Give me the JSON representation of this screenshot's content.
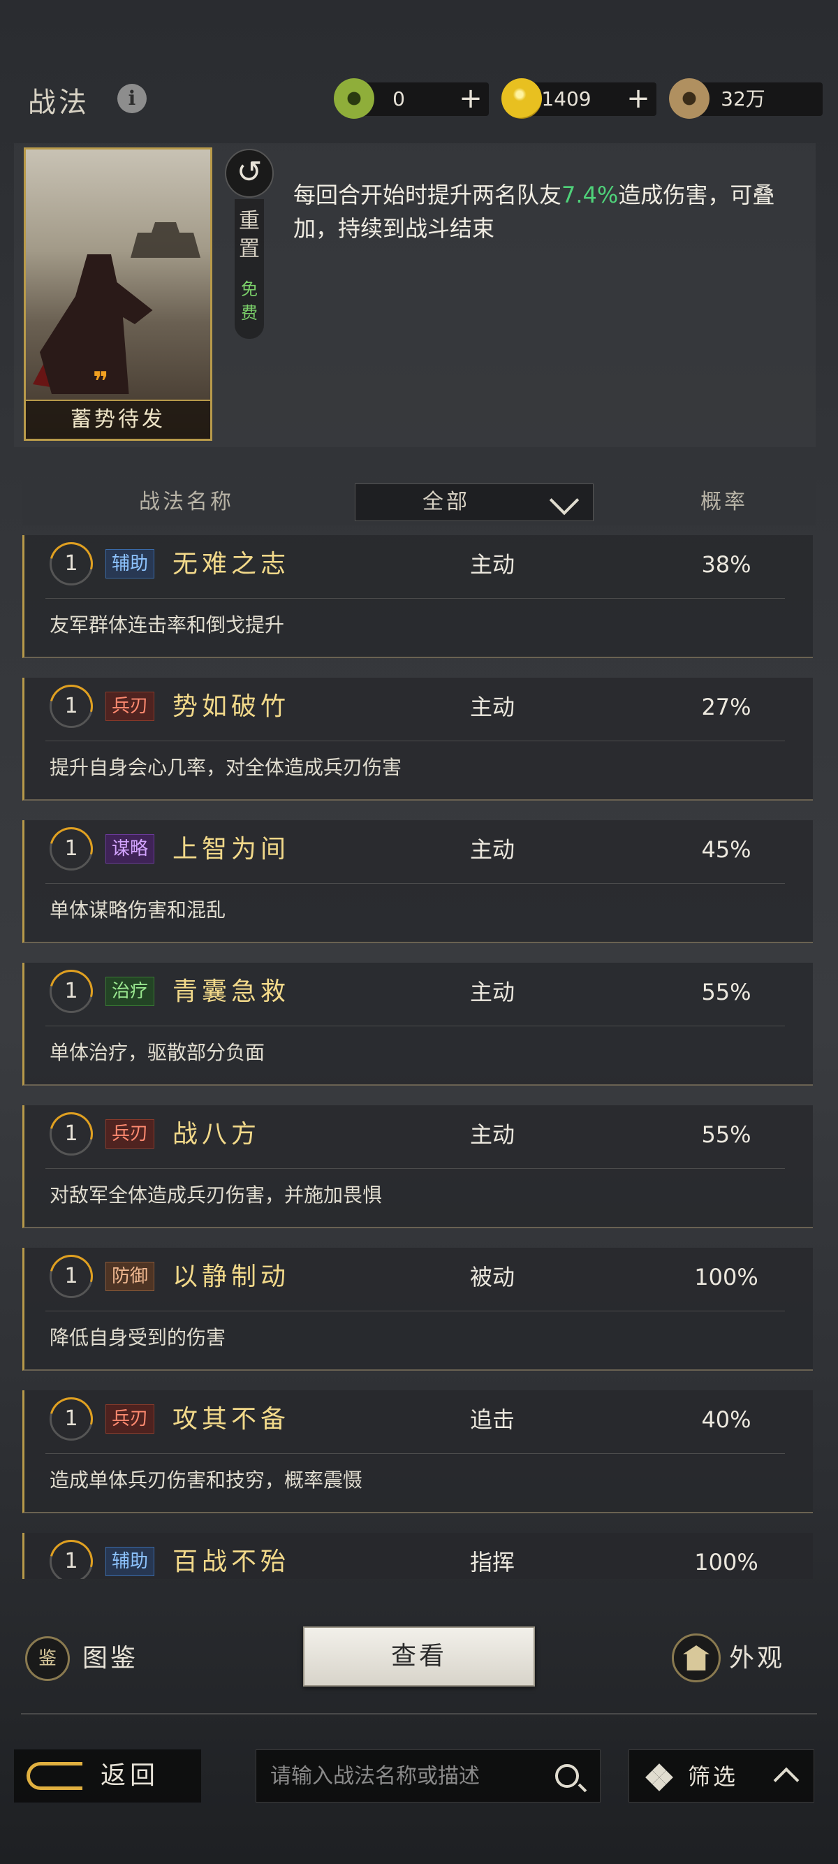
{
  "header": {
    "title": "战法",
    "info_icon": "info-icon",
    "currencies": [
      {
        "icon": "jade-coin-icon",
        "value": "0",
        "plus": "+"
      },
      {
        "icon": "gold-coin-icon",
        "value": "1409",
        "plus": "+"
      },
      {
        "icon": "copper-coin-icon",
        "value": "32万"
      }
    ]
  },
  "hero": {
    "card_name": "蓄势待发",
    "reset_icon": "refresh-icon",
    "reset_label": "重置",
    "free_label": "免费",
    "description_pre": "每回合开始时提升两名队友",
    "description_highlight": "7.4%",
    "description_post": "造成伤害，可叠加，持续到战斗结束",
    "highlight_color": "#4fd27a"
  },
  "table": {
    "col_name": "战法名称",
    "filter_value": "全部",
    "col_rate": "概率"
  },
  "skills": [
    {
      "level": "1",
      "tag": "辅助",
      "tag_style": "blue",
      "name": "无难之志",
      "type": "主动",
      "rate": "38%",
      "desc": "友军群体连击率和倒戈提升"
    },
    {
      "level": "1",
      "tag": "兵刃",
      "tag_style": "red",
      "name": "势如破竹",
      "type": "主动",
      "rate": "27%",
      "desc": "提升自身会心几率，对全体造成兵刃伤害"
    },
    {
      "level": "1",
      "tag": "谋略",
      "tag_style": "purple",
      "name": "上智为间",
      "type": "主动",
      "rate": "45%",
      "desc": "单体谋略伤害和混乱"
    },
    {
      "level": "1",
      "tag": "治疗",
      "tag_style": "green",
      "name": "青囊急救",
      "type": "主动",
      "rate": "55%",
      "desc": "单体治疗，驱散部分负面"
    },
    {
      "level": "1",
      "tag": "兵刃",
      "tag_style": "red",
      "name": "战八方",
      "type": "主动",
      "rate": "55%",
      "desc": "对敌军全体造成兵刃伤害，并施加畏惧"
    },
    {
      "level": "1",
      "tag": "防御",
      "tag_style": "brown",
      "name": "以静制动",
      "type": "被动",
      "rate": "100%",
      "desc": "降低自身受到的伤害"
    },
    {
      "level": "1",
      "tag": "兵刃",
      "tag_style": "red",
      "name": "攻其不备",
      "type": "追击",
      "rate": "40%",
      "desc": "造成单体兵刃伤害和技穷，概率震慑"
    },
    {
      "level": "1",
      "tag": "辅助",
      "tag_style": "blue",
      "name": "百战不殆",
      "type": "指挥",
      "rate": "100%",
      "desc": ""
    }
  ],
  "actions": {
    "dex_icon_text": "鉴",
    "dex_label": "图鉴",
    "view_label": "查看",
    "appearance_label": "外观"
  },
  "bottom": {
    "back_label": "返回",
    "search_placeholder": "请输入战法名称或描述",
    "filter_label": "筛选"
  }
}
